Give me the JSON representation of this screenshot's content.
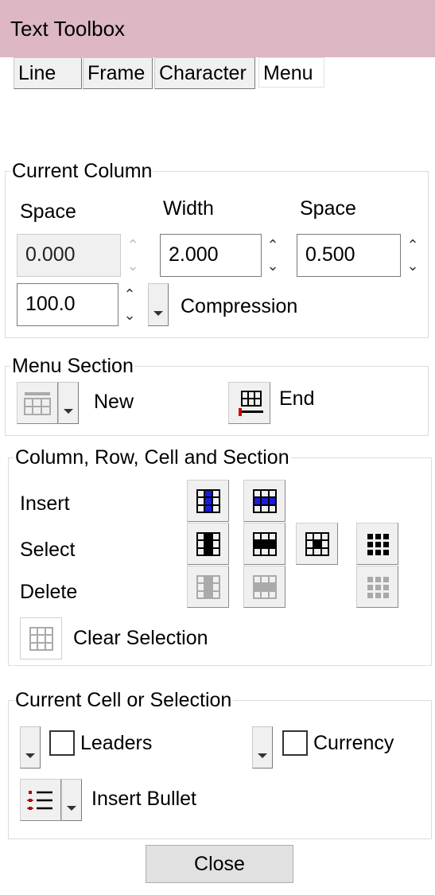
{
  "window": {
    "title": "Text Toolbox"
  },
  "tabs": [
    {
      "label": "Line",
      "active": false
    },
    {
      "label": "Frame",
      "active": false
    },
    {
      "label": "Character",
      "active": false
    },
    {
      "label": "Menu",
      "active": true
    }
  ],
  "current_column": {
    "title": "Current Column",
    "space_left_label": "Space",
    "width_label": "Width",
    "space_right_label": "Space",
    "space_left_value": "0.000",
    "width_value": "2.000",
    "space_right_value": "0.500",
    "compression_value": "100.0",
    "compression_label": "Compression"
  },
  "menu_section": {
    "title": "Menu Section",
    "new_label": "New",
    "end_label": "End"
  },
  "crcs": {
    "title": "Column, Row, Cell and Section",
    "insert_label": "Insert",
    "select_label": "Select",
    "delete_label": "Delete",
    "clear_selection_label": "Clear Selection"
  },
  "current_cell": {
    "title": "Current Cell or Selection",
    "leaders_label": "Leaders",
    "currency_label": "Currency",
    "insert_bullet_label": "Insert Bullet"
  },
  "close_label": "Close",
  "colors": {
    "titlebar": "#ddb7c4",
    "accent_blue": "#1a1adc",
    "bullet_red": "#b00000"
  }
}
